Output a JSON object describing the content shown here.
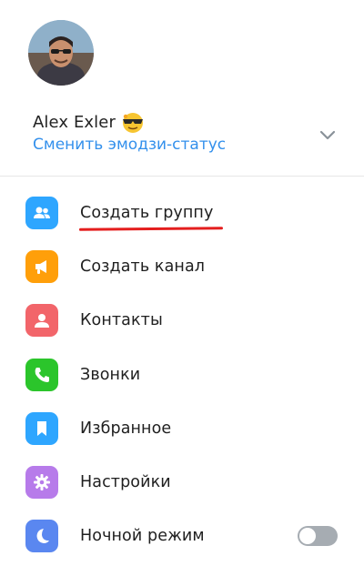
{
  "profile": {
    "name": "Alex Exler",
    "change_status_label": "Сменить эмодзи-статус"
  },
  "icons": {
    "avatar": "avatar-photo",
    "emoji_status": "sunglasses-face-emoji",
    "expand": "chevron-down-icon"
  },
  "menu": {
    "items": [
      {
        "label": "Создать группу",
        "icon": "group-icon",
        "color": "#2ea6ff"
      },
      {
        "label": "Создать канал",
        "icon": "megaphone-icon",
        "color": "#ff9f0a"
      },
      {
        "label": "Контакты",
        "icon": "contact-icon",
        "color": "#f2656a"
      },
      {
        "label": "Звонки",
        "icon": "phone-icon",
        "color": "#2bc52b"
      },
      {
        "label": "Избранное",
        "icon": "bookmark-icon",
        "color": "#2ea6ff"
      },
      {
        "label": "Настройки",
        "icon": "gear-icon",
        "color": "#b77bea"
      },
      {
        "label": "Ночной режим",
        "icon": "moon-icon",
        "color": "#5a87f0"
      }
    ]
  },
  "night_mode": {
    "enabled": false
  },
  "accent_colors": {
    "link": "#3390ec",
    "highlight_underline": "#e41e1e"
  }
}
